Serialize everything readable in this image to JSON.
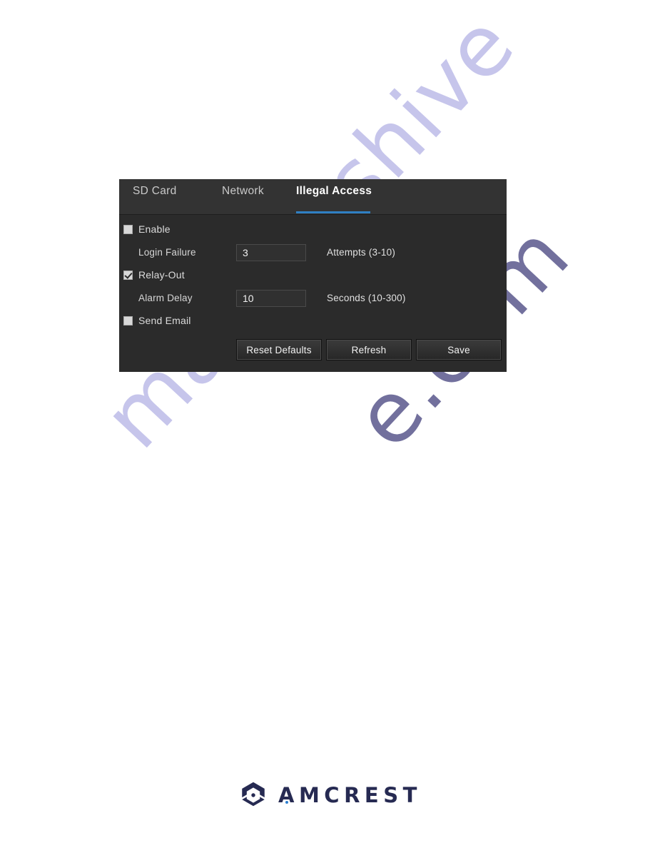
{
  "page": {
    "background_color": "#ffffff"
  },
  "watermark": {
    "primary_text": "manualshive",
    "secondary_text": "e.com",
    "primary_color": "#bdbce8",
    "secondary_color": "#3c3a78"
  },
  "panel": {
    "background_color": "#2b2b2b",
    "tab_bar_color": "#333333",
    "accent_color": "#2f80c4",
    "tabs": [
      {
        "id": "sd-card",
        "label": "SD Card",
        "active": false
      },
      {
        "id": "network",
        "label": "Network",
        "active": false
      },
      {
        "id": "illegal-access",
        "label": "Illegal Access",
        "active": true
      }
    ],
    "form": {
      "enable": {
        "label": "Enable",
        "checked": false
      },
      "login_failure": {
        "label": "Login Failure",
        "value": "3",
        "unit": "Attempts (3-10)"
      },
      "relay_out": {
        "label": "Relay-Out",
        "checked": true
      },
      "alarm_delay": {
        "label": "Alarm Delay",
        "value": "10",
        "unit": "Seconds (10-300)"
      },
      "send_email": {
        "label": "Send Email",
        "checked": false
      }
    },
    "buttons": {
      "reset_defaults": "Reset Defaults",
      "refresh": "Refresh",
      "save": "Save"
    }
  },
  "footer": {
    "brand_name": "AMCREST",
    "brand_color": "#262a52",
    "accent_dot_color": "#2d7fd0"
  }
}
